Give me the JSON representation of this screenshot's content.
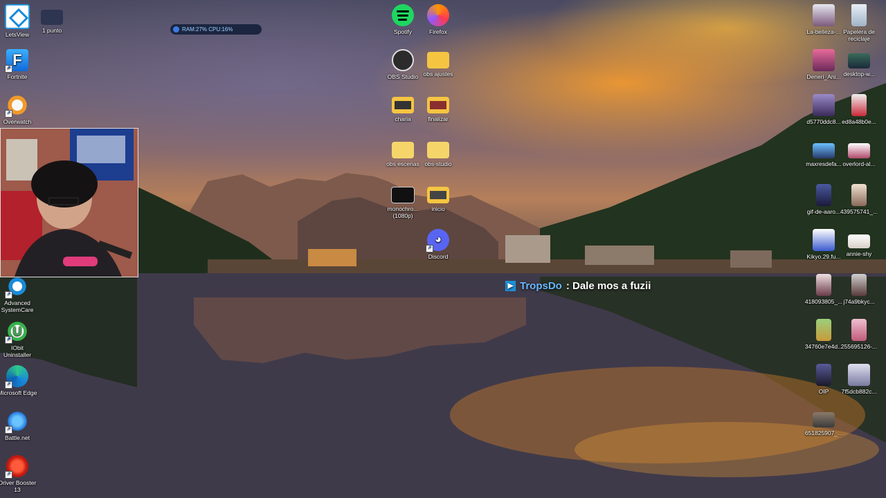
{
  "overlay": {
    "ram_cpu": "RAM:27%  CPU:16%",
    "chat_user": "TropsDo",
    "chat_message": ": Dale mos a fuzii"
  },
  "icons": {
    "letsview": "LetsView",
    "unpunto": "1 punto",
    "fortnite": "Fortnite",
    "overwatch": "Overwatch",
    "advanced_systemcare": "Advanced SystemCare",
    "iobit": "IObit Uninstaller",
    "edge": "Microsoft Edge",
    "battlenet": "Battle.net",
    "driver_booster": "Driver Booster 13",
    "spotify": "Spotify",
    "firefox": "Firefox",
    "obs_studio": "OBS Studio",
    "obs_ajustes": "obs ajustes",
    "charla": "charla",
    "finalizar": "finalizar",
    "obs_escenas": "obs escenas",
    "obs_studio_folder": "obs-studio",
    "monochro": "monochro... (1080p)",
    "inicio": "inicio",
    "discord": "Discord",
    "la_belleza": "La-belleza-...",
    "papelera": "Papelera de reciclaje",
    "deneri": "Deneri_Ani...",
    "desktop_w": "desktop-w...",
    "d5770": "d5770ddc8...",
    "ed8a": "ed8a48b0e...",
    "maxresdef": "maxresdefa...",
    "overlord": "overlord-al...",
    "gif_aaro": "gif-de-aaro...",
    "n439": "439575741_...",
    "kikyo": "Kikyo.29.fu...",
    "annie": "annie-shy",
    "n4180": "418093805_...",
    "j74a": "j74a9bkyc...",
    "n3476": "34760e7e4d...",
    "n2556": "255695126-...",
    "oip": "OIP",
    "n7f5d": "7f5dcb882c...",
    "n6518": "651825907_..."
  }
}
